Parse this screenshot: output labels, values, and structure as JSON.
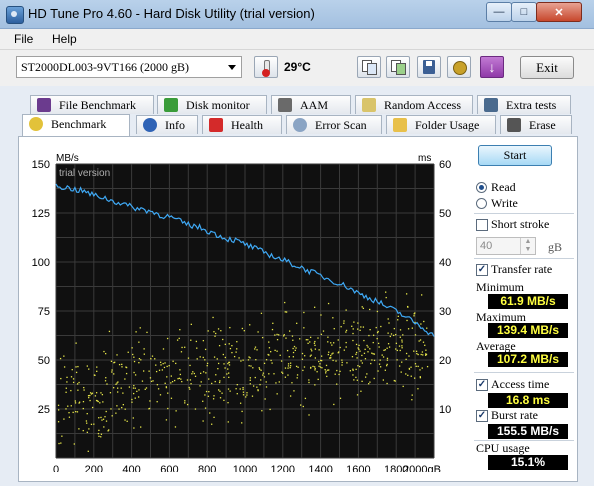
{
  "window": {
    "title": "HD Tune Pro 4.60 - Hard Disk Utility (trial version)"
  },
  "menu": {
    "file": "File",
    "help": "Help"
  },
  "toolbar": {
    "drive": "ST2000DL003-9VT166 (2000 gB)",
    "temperature": "29°C",
    "exit_label": "Exit"
  },
  "tabs": {
    "row1": [
      "File Benchmark",
      "Disk monitor",
      "AAM",
      "Random Access",
      "Extra tests"
    ],
    "row2": [
      "Benchmark",
      "Info",
      "Health",
      "Error Scan",
      "Folder Usage",
      "Erase"
    ]
  },
  "right_panel": {
    "start_label": "Start",
    "read_label": "Read",
    "write_label": "Write",
    "short_stroke_label": "Short stroke",
    "short_stroke_value": "40",
    "short_stroke_unit": "gB",
    "transfer_rate_label": "Transfer rate",
    "minimum_label": "Minimum",
    "minimum_value": "61.9 MB/s",
    "maximum_label": "Maximum",
    "maximum_value": "139.4 MB/s",
    "average_label": "Average",
    "average_value": "107.2 MB/s",
    "access_time_label": "Access time",
    "access_time_value": "16.8 ms",
    "burst_rate_label": "Burst rate",
    "burst_rate_value": "155.5 MB/s",
    "cpu_usage_label": "CPU usage",
    "cpu_usage_value": "15.1%",
    "read_selected": true,
    "transfer_rate_checked": true,
    "access_time_checked": true,
    "burst_rate_checked": true
  },
  "chart_data": {
    "type": "line",
    "watermark": "trial version",
    "xlabel_unit": "gB",
    "left_axis_unit": "MB/s",
    "right_axis_unit": "ms",
    "xlim": [
      0,
      2000
    ],
    "ylim_left": [
      0,
      150
    ],
    "ylim_right": [
      0,
      60
    ],
    "x_ticks": [
      "0",
      "200",
      "400",
      "600",
      "800",
      "1000",
      "1200",
      "1400",
      "1600",
      "1800",
      "2000gB"
    ],
    "y_ticks_left": [
      "150",
      "125",
      "100",
      "75",
      "50",
      "25"
    ],
    "y_ticks_right": [
      "60",
      "50",
      "40",
      "30",
      "20",
      "10"
    ],
    "grid": true,
    "colors": {
      "background": "#101010",
      "grid": "#3a3a3a",
      "transfer": "#3fa9f5",
      "access": "#e8e84a"
    },
    "series": [
      {
        "x": [
          0,
          50,
          100,
          150,
          200,
          250,
          300,
          350,
          400,
          450,
          500,
          550,
          600,
          650,
          700,
          750,
          800,
          850,
          900,
          950,
          1000,
          1050,
          1100,
          1150,
          1200,
          1250,
          1300,
          1350,
          1400,
          1450,
          1500,
          1550,
          1600,
          1650,
          1700,
          1750,
          1800,
          1850,
          1900,
          1950,
          2000
        ],
        "values": [
          139,
          138,
          137,
          136,
          134,
          133,
          131,
          130,
          128,
          127,
          126,
          124,
          123,
          121,
          119,
          118,
          116,
          114,
          112,
          111,
          109,
          107,
          105,
          103,
          101,
          99,
          97,
          95,
          93,
          91,
          89,
          87,
          84,
          82,
          80,
          77,
          75,
          72,
          69,
          66,
          62
        ]
      },
      {
        "x": [
          0,
          100,
          200,
          300,
          400,
          500,
          600,
          700,
          800,
          900,
          1000,
          1100,
          1200,
          1300,
          1400,
          1500,
          1600,
          1700,
          1800,
          1900,
          2000
        ],
        "values": [
          11.5,
          12.5,
          13.5,
          14.5,
          15.5,
          16,
          16.5,
          17,
          17.5,
          18,
          18.5,
          19,
          19.5,
          20,
          20.5,
          21,
          21.5,
          22,
          22.5,
          23,
          23.5
        ]
      }
    ]
  }
}
